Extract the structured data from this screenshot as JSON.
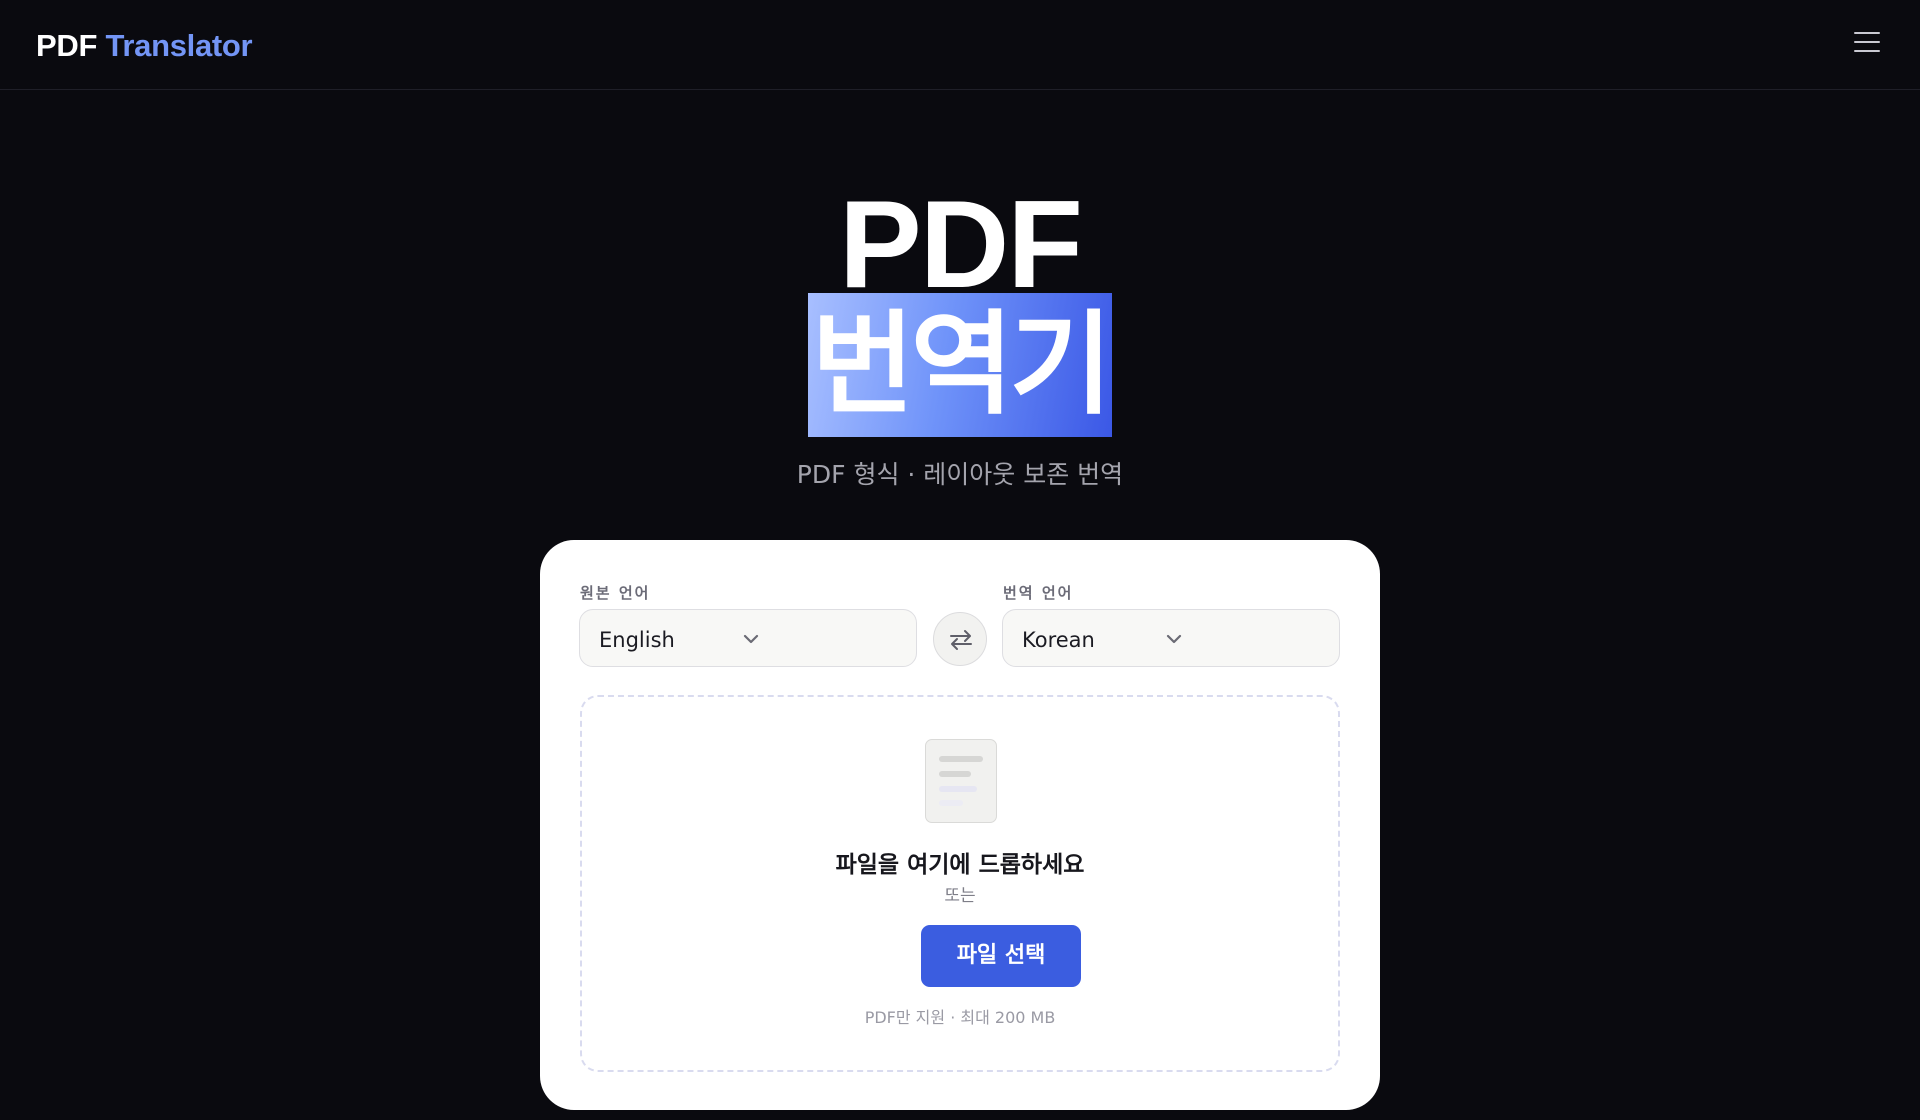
{
  "header": {
    "brand_pdf": "PDF",
    "brand_translator": "Translator",
    "menu_icon": "hamburger-menu-icon"
  },
  "hero": {
    "title_line1": "PDF",
    "title_line2": "번역기",
    "subtitle": "PDF 형식 · 레이아웃 보존 번역",
    "highlight_gradient": [
      "#a8bfff",
      "#6f93f9",
      "#3b58e6"
    ]
  },
  "translator": {
    "source_label": "원본 언어",
    "source_value": "English",
    "target_label": "번역 언어",
    "target_value": "Korean",
    "swap_icon": "swap-arrows-icon",
    "chevron_icon": "chevron-down-icon"
  },
  "upload": {
    "file_icon": "document-icon",
    "drop_title": "파일을 여기에 드롭하세요",
    "or_text": "또는",
    "choose_button": "파일 선택",
    "note": "PDF만 지원 · 최대 200 MB"
  },
  "colors": {
    "background": "#0a0a0f",
    "accent": "#3b5de0",
    "brand_accent": "#7395f5",
    "card": "#ffffff"
  }
}
